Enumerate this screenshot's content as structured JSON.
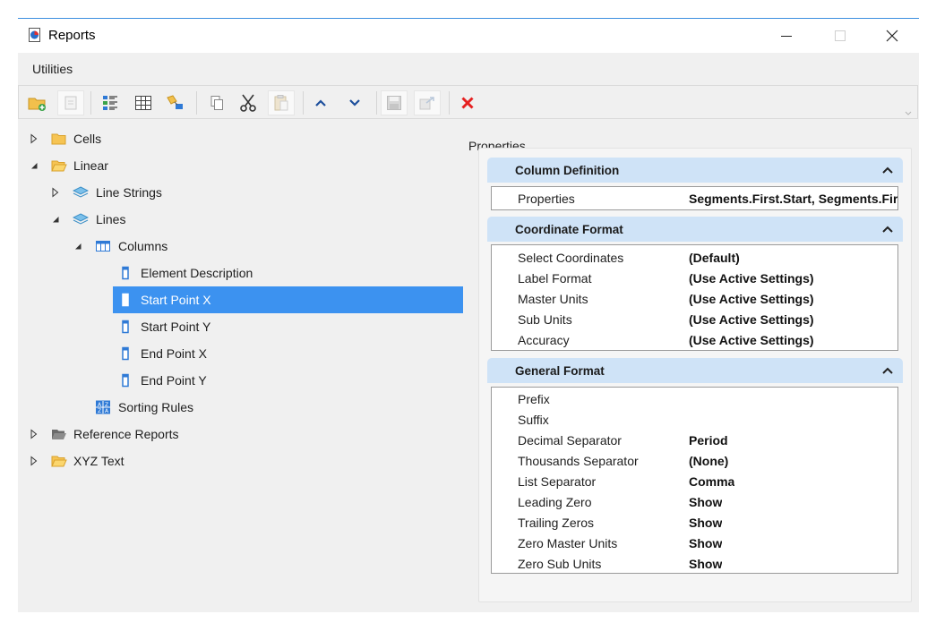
{
  "window": {
    "title": "Reports"
  },
  "menu": {
    "utilities": "Utilities"
  },
  "toolbar": {
    "buttons": [
      "new-folder-icon",
      "new-report-icon",
      "column-list-icon",
      "table-icon",
      "sort-icon",
      "copy-icon",
      "cut-icon",
      "paste-icon",
      "move-up-icon",
      "move-down-icon",
      "save-icon",
      "export-icon",
      "delete-icon"
    ]
  },
  "tree": {
    "cells": "Cells",
    "linear": "Linear",
    "line_strings": "Line Strings",
    "lines": "Lines",
    "columns": "Columns",
    "element_description": "Element Description",
    "start_point_x": "Start Point X",
    "start_point_y": "Start Point Y",
    "end_point_x": "End Point X",
    "end_point_y": "End Point Y",
    "sorting_rules": "Sorting Rules",
    "reference_reports": "Reference Reports",
    "xyz_text": "XYZ Text"
  },
  "properties": {
    "label": "Properties",
    "column_definition": {
      "title": "Column Definition",
      "rows": [
        {
          "name": "Properties",
          "value": "Segments.First.Start, Segments.First.Start"
        }
      ]
    },
    "coordinate_format": {
      "title": "Coordinate Format",
      "rows": [
        {
          "name": "Select Coordinates",
          "value": "(Default)"
        },
        {
          "name": "Label Format",
          "value": "(Use Active Settings)"
        },
        {
          "name": "Master Units",
          "value": "(Use Active Settings)"
        },
        {
          "name": "Sub Units",
          "value": "(Use Active Settings)"
        },
        {
          "name": "Accuracy",
          "value": "(Use Active Settings)"
        }
      ]
    },
    "general_format": {
      "title": "General Format",
      "rows": [
        {
          "name": "Prefix",
          "value": ""
        },
        {
          "name": "Suffix",
          "value": ""
        },
        {
          "name": "Decimal Separator",
          "value": "Period"
        },
        {
          "name": "Thousands Separator",
          "value": "(None)"
        },
        {
          "name": "List Separator",
          "value": "Comma"
        },
        {
          "name": "Leading Zero",
          "value": "Show"
        },
        {
          "name": "Trailing Zeros",
          "value": "Show"
        },
        {
          "name": "Zero Master Units",
          "value": "Show"
        },
        {
          "name": "Zero Sub Units",
          "value": "Show"
        }
      ]
    }
  },
  "colors": {
    "accent": "#3c92f0",
    "group_header": "#cfe3f7",
    "delete": "#e52020"
  }
}
